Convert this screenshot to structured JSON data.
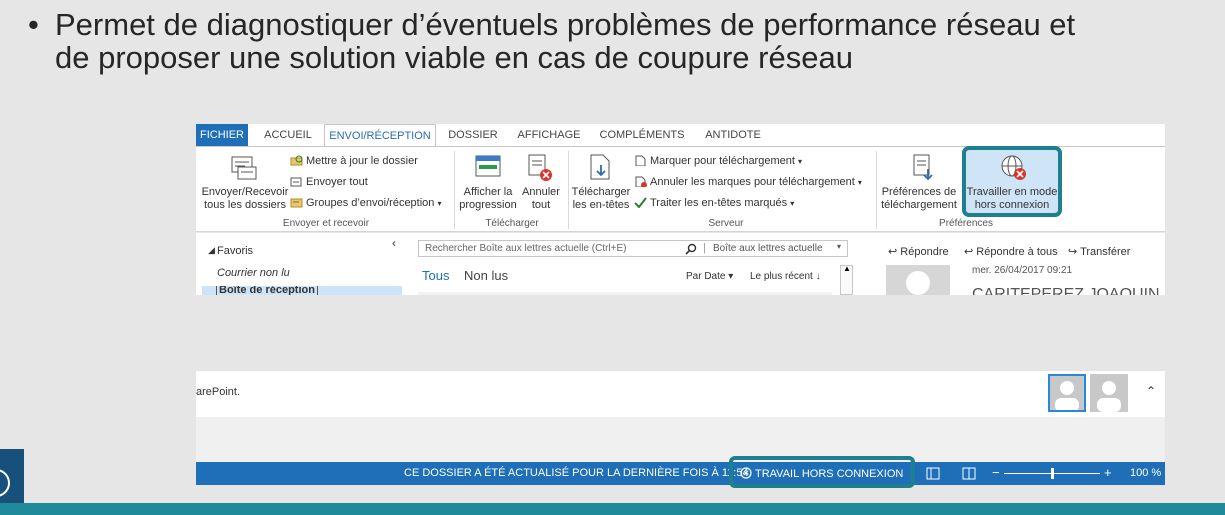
{
  "slide": {
    "bullet": "•",
    "text_line1": "Permet de diagnostiquer d’éventuels problèmes de performance réseau et",
    "text_line2": "de proposer une solution viable en cas de coupure réseau"
  },
  "ribbon": {
    "tabs": [
      "FICHIER",
      "ACCUEIL",
      "ENVOI/RÉCEPTION",
      "DOSSIER",
      "AFFICHAGE",
      "COMPLÉMENTS",
      "ANTIDOTE"
    ],
    "active_tab": "ENVOI/RÉCEPTION",
    "send_receive_all": [
      "Envoyer/Recevoir",
      "tous les dossiers"
    ],
    "update_folder": "Mettre à jour le dossier",
    "send_all": "Envoyer tout",
    "groups_sr": "Groupes d’envoi/réception",
    "group_send_receive": "Envoyer et recevoir",
    "show_progress": [
      "Afficher la",
      "progression"
    ],
    "cancel_all": [
      "Annuler",
      "tout"
    ],
    "group_download": "Télécharger",
    "download_headers": [
      "Télécharger",
      "les en-têtes"
    ],
    "mark_download": "Marquer pour téléchargement",
    "unmark_download": "Annuler les marques pour téléchargement",
    "process_marked": "Traiter les en-têtes marqués",
    "group_server": "Serveur",
    "download_prefs": [
      "Préférences de",
      "téléchargement"
    ],
    "work_offline": [
      "Travailler en mode",
      "hors connexion"
    ],
    "group_prefs": "Préférences"
  },
  "pane": {
    "favorites": "Favoris",
    "unread_mail": "Courrier non lu",
    "inbox_partial": "Boîte de réception",
    "search_placeholder": "Rechercher Boîte aux lettres actuelle (Ctrl+E)",
    "scope": "Boîte aux lettres actuelle",
    "filter_all": "Tous",
    "filter_unread": "Non lus",
    "sort_by": "Par Date",
    "sort_order": "Le plus récent",
    "reply": "Répondre",
    "reply_all": "Répondre à tous",
    "forward": "Transférer",
    "msg_date": "mer. 26/04/2017 09:21",
    "sender_partial": "CARITEPEREZ JOAQUIN"
  },
  "people": {
    "sharepoint_text": "arePoint."
  },
  "statusbar": {
    "updated": "CE DOSSIER A ÉTÉ ACTUALISÉ POUR LA DERNIÈRE FOIS À 11:54.",
    "offline": "TRAVAIL HORS CONNEXION",
    "zoom": "100 %",
    "zoom_fraction": 0.5
  },
  "colors": {
    "accent": "#1e6fb8",
    "highlight": "#1e7f8e",
    "footer": "#1f8a99"
  }
}
